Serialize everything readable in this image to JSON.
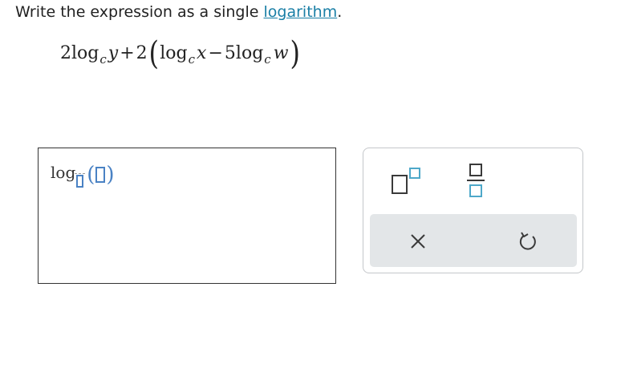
{
  "prompt": {
    "text_before": "Write the expression as a single ",
    "link_text": "logarithm",
    "text_after": "."
  },
  "expression": {
    "coef1": "2",
    "log1": "log",
    "base1": "c",
    "var1": "y",
    "op1": "+",
    "coef2": "2",
    "paren_open": "(",
    "log2": "log",
    "base2": "c",
    "var2": "x",
    "op2": "−",
    "coef3": "5",
    "log3": "log",
    "base3": "c",
    "var3": "w",
    "paren_close": ")"
  },
  "answer": {
    "log_prefix": "log",
    "paren_open": "(",
    "paren_close": ")"
  },
  "toolbar": {
    "icons": {
      "superscript": "superscript-template-icon",
      "fraction": "fraction-template-icon",
      "clear": "clear-x-icon",
      "undo": "undo-arrow-icon"
    },
    "colors": {
      "accent": "#4a82c4",
      "icon_stroke": "#3a3a3a",
      "icon_fill_blue": "#4ea8c9",
      "button_row_bg": "#e3e6e8"
    }
  }
}
